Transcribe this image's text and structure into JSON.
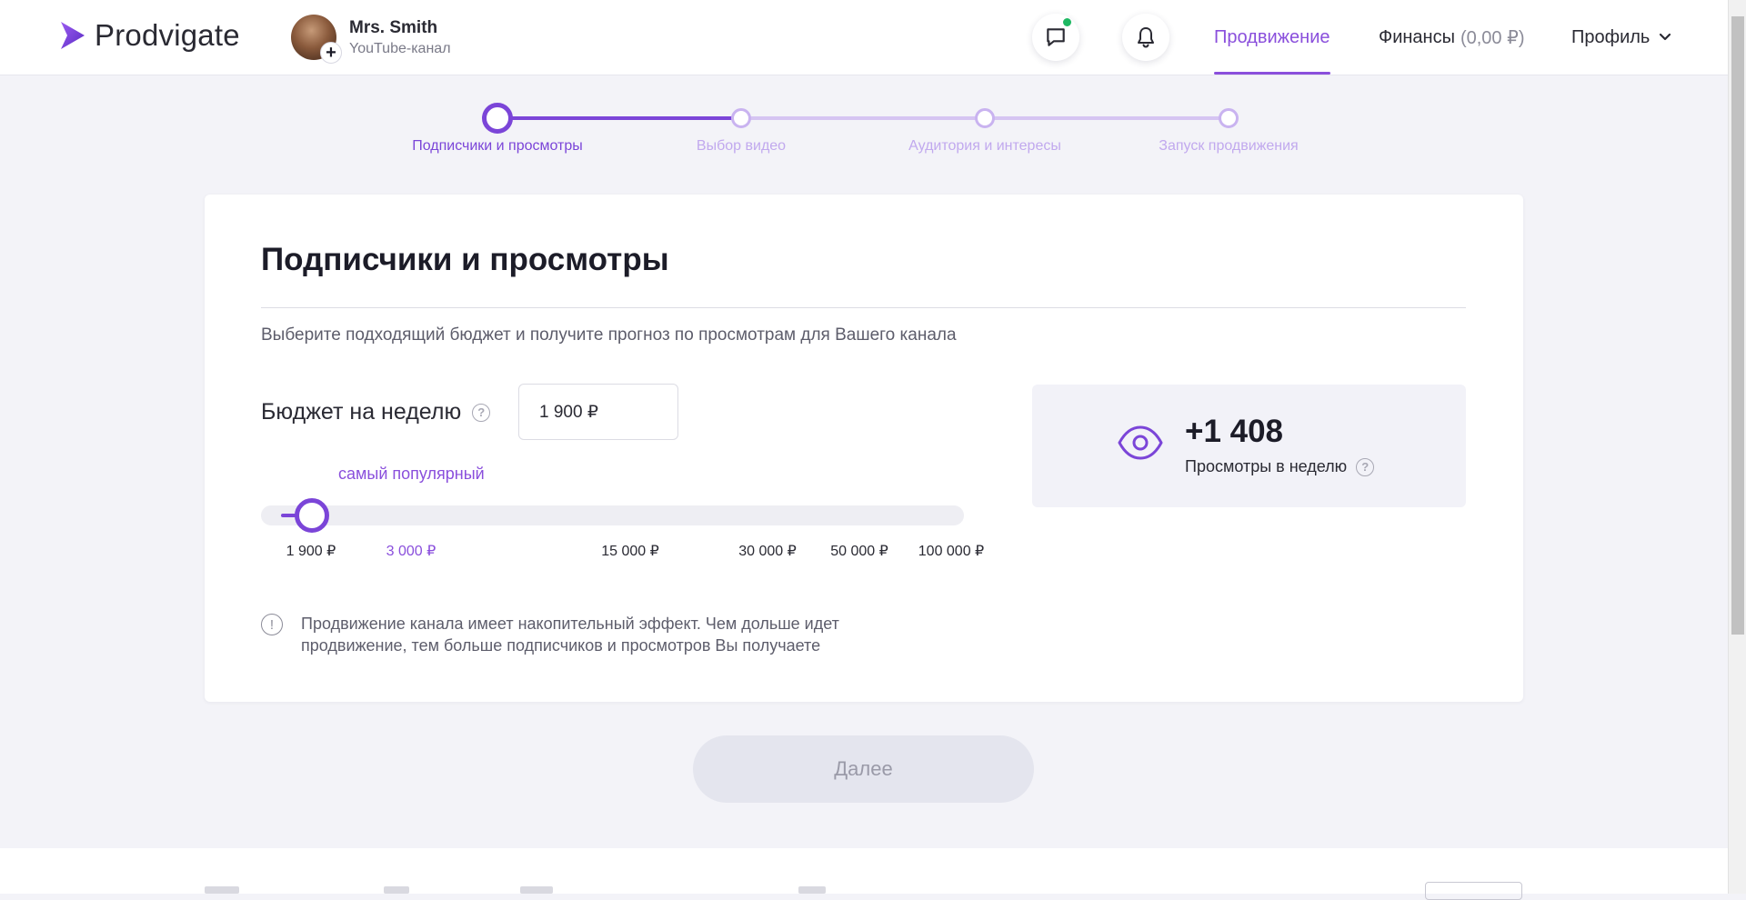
{
  "header": {
    "logo_text": "Prodvigate",
    "channel": {
      "name": "Mrs. Smith",
      "type": "YouTube-канал"
    },
    "nav": {
      "promotion": "Продвижение",
      "finance": "Финансы",
      "finance_balance": "(0,00 ₽)",
      "profile": "Профиль"
    },
    "icons": {
      "chat": "chat-icon",
      "bell": "bell-icon",
      "chevron": "chevron-down-icon"
    }
  },
  "stepper": {
    "current_index": 0,
    "steps": [
      {
        "label": "Подписчики и просмотры"
      },
      {
        "label": "Выбор видео"
      },
      {
        "label": "Аудитория и интересы"
      },
      {
        "label": "Запуск продвижения"
      }
    ]
  },
  "card": {
    "title": "Подписчики и просмотры",
    "subtitle": "Выберите подходящий бюджет и получите прогноз по просмотрам для Вашего канала",
    "budget": {
      "label": "Бюджет на неделю",
      "value": "1 900 ₽",
      "popular_label": "самый популярный",
      "ticks": [
        "1 900 ₽",
        "3 000 ₽",
        "15 000 ₽",
        "30 000 ₽",
        "50 000 ₽",
        "100 000 ₽"
      ],
      "popular_tick_index": 1,
      "selected_tick_index": 0
    },
    "forecast": {
      "value": "+1 408",
      "label": "Просмотры в неделю"
    },
    "notice": "Продвижение канала имеет накопительный эффект. Чем дольше идет продвижение, тем больше подписчиков и просмотров Вы получаете"
  },
  "actions": {
    "next": "Далее"
  },
  "colors": {
    "accent": "#7b45d8",
    "accent_text": "#8a4fdc",
    "accent_light": "#d5c4f2",
    "background": "#f3f3f8",
    "online_dot": "#1fb863"
  }
}
